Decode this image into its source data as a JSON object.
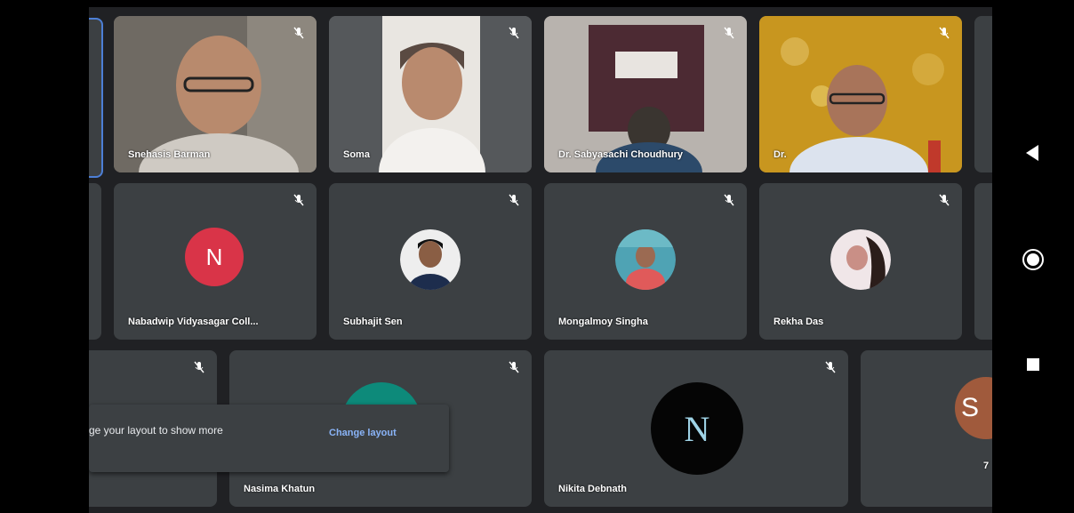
{
  "participants_row1": [
    {
      "name": "Snehasis Barman"
    },
    {
      "name": "Soma"
    },
    {
      "name": "Dr. Sabyasachi Choudhury"
    },
    {
      "name": "Dr."
    }
  ],
  "participants_row2": [
    {
      "name": "Nabadwip Vidyasagar Coll...",
      "initial": "N",
      "avatar_color": "#d93448"
    },
    {
      "name": "Subhajit Sen"
    },
    {
      "name": "Mongalmoy Singha"
    },
    {
      "name": "Rekha Das"
    }
  ],
  "participants_row3": [
    {
      "name": "Nasima Khatun"
    },
    {
      "name": "Nikita Debnath",
      "initial": "N"
    },
    {
      "name": "7",
      "initial": "S",
      "avatar_color": "#a05a3c"
    }
  ],
  "toast": {
    "message": "ge your layout to show more",
    "action": "Change layout"
  },
  "colors": {
    "background": "#202124",
    "tile": "#3c4043",
    "accent": "#8ab4f8"
  },
  "icons": {
    "mute": "mic-off-icon",
    "back": "back-triangle-icon",
    "home": "home-circle-icon",
    "recents": "recents-square-icon"
  }
}
